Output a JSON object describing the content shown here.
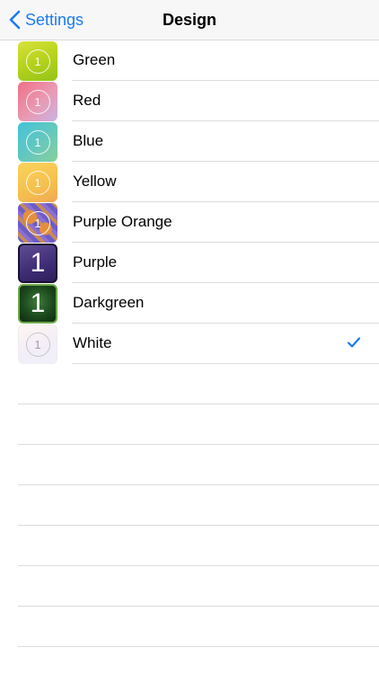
{
  "nav": {
    "back_label": "Settings",
    "title": "Design"
  },
  "designs": [
    {
      "label": "Green",
      "icon": "green-theme-icon",
      "number": "1",
      "selected": false
    },
    {
      "label": "Red",
      "icon": "red-theme-icon",
      "number": "1",
      "selected": false
    },
    {
      "label": "Blue",
      "icon": "blue-theme-icon",
      "number": "1",
      "selected": false
    },
    {
      "label": "Yellow",
      "icon": "yellow-theme-icon",
      "number": "1",
      "selected": false
    },
    {
      "label": "Purple Orange",
      "icon": "purple-orange-theme-icon",
      "number": "1",
      "selected": false
    },
    {
      "label": "Purple",
      "icon": "purple-theme-icon",
      "number": "1",
      "selected": false
    },
    {
      "label": "Darkgreen",
      "icon": "darkgreen-theme-icon",
      "number": "1",
      "selected": false
    },
    {
      "label": "White",
      "icon": "white-theme-icon",
      "number": "1",
      "selected": true
    }
  ],
  "colors": {
    "accent": "#1a7cf0",
    "separator": "#dcdcdc",
    "navbar_bg": "#f7f7f7"
  }
}
